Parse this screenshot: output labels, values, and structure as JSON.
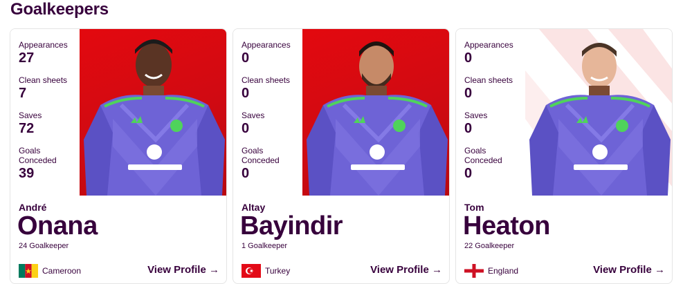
{
  "section": {
    "title": "Goalkeepers"
  },
  "stat_labels": {
    "appearances": "Appearances",
    "clean_sheets": "Clean sheets",
    "saves": "Saves",
    "goals_conceded_line1": "Goals",
    "goals_conceded_line2": "Conceded"
  },
  "players": [
    {
      "first_name": "André",
      "last_name": "Onana",
      "position_line": "24 Goalkeeper",
      "country": "Cameroon",
      "flag": "cameroon-flag",
      "stats": {
        "appearances": "27",
        "clean_sheets": "7",
        "saves": "72",
        "goals_conceded": "39"
      },
      "view_profile": "View Profile →"
    },
    {
      "first_name": "Altay",
      "last_name": "Bayindir",
      "position_line": "1 Goalkeeper",
      "country": "Turkey",
      "flag": "turkey-flag",
      "stats": {
        "appearances": "0",
        "clean_sheets": "0",
        "saves": "0",
        "goals_conceded": "0"
      },
      "view_profile": "View Profile →"
    },
    {
      "first_name": "Tom",
      "last_name": "Heaton",
      "position_line": "22 Goalkeeper",
      "country": "England",
      "flag": "england-flag",
      "stats": {
        "appearances": "0",
        "clean_sheets": "0",
        "saves": "0",
        "goals_conceded": "0"
      },
      "view_profile": "View Profile →"
    }
  ],
  "colors": {
    "brand_purple": "#37003c",
    "photo_red": "#d00a12",
    "kit_purple": "#6e63d6",
    "kit_green": "#4fd35b"
  }
}
